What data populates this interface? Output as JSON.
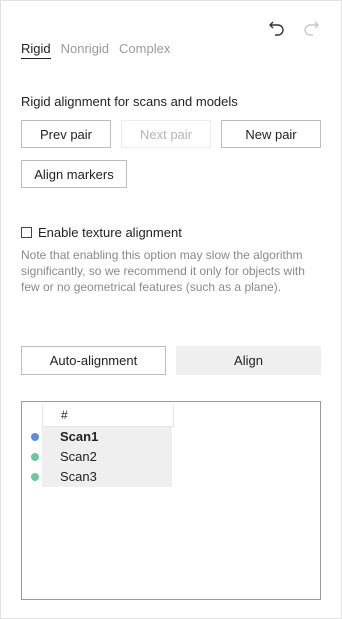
{
  "toolbar": {
    "undo_icon": "undo-icon",
    "redo_icon": "redo-icon"
  },
  "tabs": [
    {
      "label": "Rigid",
      "active": true
    },
    {
      "label": "Nonrigid",
      "active": false
    },
    {
      "label": "Complex",
      "active": false
    }
  ],
  "section_title": "Rigid alignment for scans and models",
  "buttons": {
    "prev_pair": "Prev pair",
    "next_pair": "Next pair",
    "new_pair": "New pair",
    "align_markers": "Align markers",
    "auto_alignment": "Auto-alignment",
    "align": "Align"
  },
  "texture": {
    "label": "Enable texture alignment",
    "checked": false,
    "note": "Note that enabling this option may slow the algorithm significantly, so we recommend it only for objects with few or no geometrical features (such as a plane)."
  },
  "scan_list": {
    "header": "#",
    "items": [
      {
        "name": "Scan1",
        "color": "#5b8fd6",
        "bold": true
      },
      {
        "name": "Scan2",
        "color": "#6cc79b",
        "bold": false
      },
      {
        "name": "Scan3",
        "color": "#6cc79b",
        "bold": false
      }
    ]
  }
}
